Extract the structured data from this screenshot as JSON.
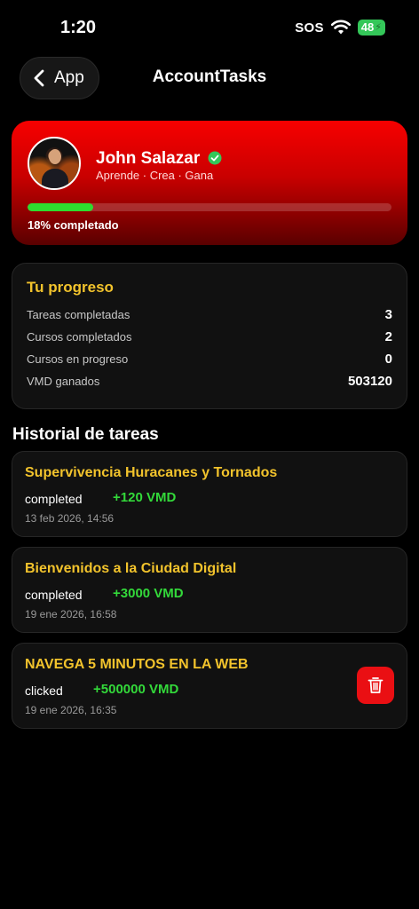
{
  "status_bar": {
    "time": "1:20",
    "sos": "SOS",
    "battery": "48"
  },
  "nav": {
    "back_label": "App",
    "title": "AccountTasks"
  },
  "profile": {
    "name": "John Salazar",
    "tagline": "Aprende · Crea · Gana",
    "progress_fraction": 0.18,
    "progress_text": "18% completado"
  },
  "stats": {
    "title": "Tu progreso",
    "rows": [
      {
        "label": "Tareas completadas",
        "value": "3"
      },
      {
        "label": "Cursos completados",
        "value": "2"
      },
      {
        "label": "Cursos en progreso",
        "value": "0"
      },
      {
        "label": "VMD ganados",
        "value": "503120"
      }
    ]
  },
  "history": {
    "title": "Historial de tareas",
    "tasks": [
      {
        "title": "Supervivencia Huracanes y Tornados",
        "status": "completed",
        "reward": "+120 VMD",
        "date": "13 feb 2026, 14:56"
      },
      {
        "title": "Bienvenidos a la Ciudad Digital",
        "status": "completed",
        "reward": "+3000 VMD",
        "date": "19 ene 2026, 16:58"
      },
      {
        "title": "NAVEGA 5 MINUTOS EN LA WEB",
        "status": "clicked",
        "reward": "+500000 VMD",
        "date": "19 ene 2026, 16:35"
      }
    ]
  },
  "colors": {
    "accent_yellow": "#f2c32c",
    "reward_green": "#33d93a",
    "danger_red": "#ea0f13"
  }
}
